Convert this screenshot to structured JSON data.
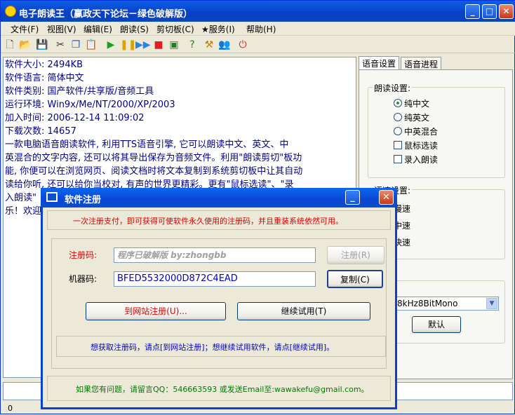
{
  "window": {
    "title": "电子朗读王（赢政天下论坛－绿色破解版）"
  },
  "menu": [
    "文件(F)",
    "视图(V)",
    "编辑(E)",
    "朗读(S)",
    "剪切板(C)",
    "★服务(I)",
    "帮助(H)"
  ],
  "main_text": {
    "lines": [
      "软件大小: 2494KB",
      "软件语言: 简体中文",
      "软件类别: 国产软件/共享版/音频工具",
      "运行环境: Win9x/Me/NT/2000/XP/2003",
      "加入时间: 2006-12-14 11:09:02",
      "下载次数: 14657",
      "    一款电脑语音朗读软件, 利用TTS语音引擎, 它可以朗读中文、英文、中",
      "英混合的文字内容, 还可以将其导出保存为音频文件。利用\"朗读剪切\"板功",
      "能, 你便可以在浏览网页、阅读文档时将文本复制到系统剪切板中让其自动",
      "读给你听, 还可以给你当校对, 有声的世界更精彩。更有\"鼠标选读\"、\"录",
      "入朗读\"",
      "乐！欢迎"
    ]
  },
  "tabs": [
    "语音设置",
    "语音进程"
  ],
  "read_settings": {
    "label": "朗读设置:",
    "options": [
      "纯中文",
      "纯英文",
      "中英混合"
    ],
    "selected": "纯中文",
    "checks": [
      "鼠标选读",
      "录入朗读"
    ]
  },
  "speed_settings": {
    "label": "语速设置:",
    "options": [
      "慢速",
      "中速",
      "快速"
    ]
  },
  "sound_settings": {
    "label": "置:",
    "format": "8kHz8BitMono",
    "default_button": "默认"
  },
  "status": {
    "value": "0"
  },
  "dialog": {
    "title": "软件注册",
    "notice": "一次注册支付，即可获得可使软件永久使用的注册码，并且重装系统依然可用。",
    "reg_code_label": "注册码:",
    "reg_code_value": "程序已破解版  by:zhongbb",
    "register_button": "注册(R)",
    "machine_code_label": "机器码:",
    "machine_code_value": "BFED5532000D872C4EAD",
    "copy_button": "复制(C)",
    "website_button": "到网站注册(U)...",
    "trial_button": "继续试用(T)",
    "hint": "想获取注册码，请点[到网站注册]；想继续试用软件，请点[继续试用]。",
    "contact": "如果您有问题，请留言QQ：546663593   或发送Email至:wawakefu@gmail.com。"
  },
  "colors": {
    "titlebar": "#0A4FD6",
    "accent_red": "#E00000",
    "link_blue": "#0000CC",
    "contact_green": "#007A00"
  }
}
